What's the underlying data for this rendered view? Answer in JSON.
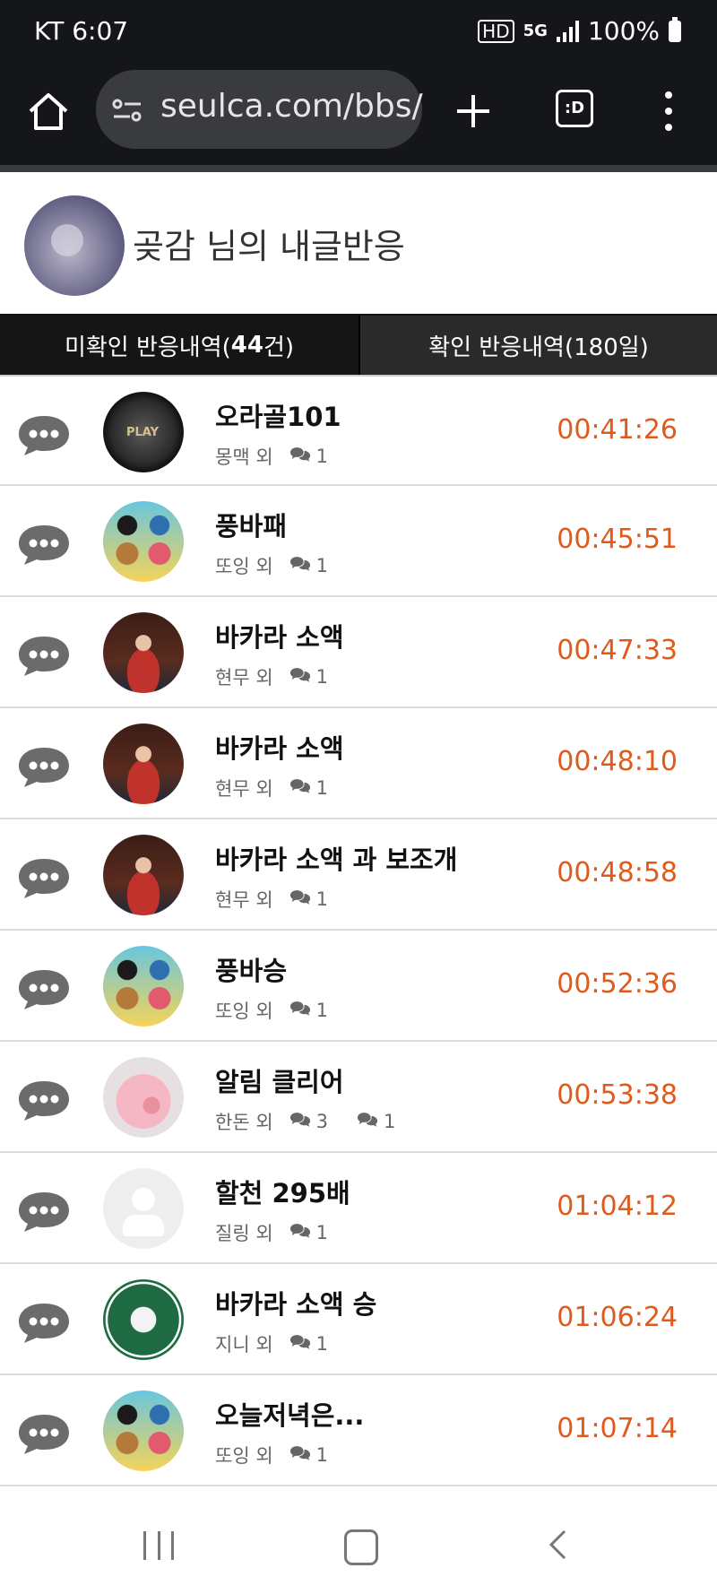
{
  "status_bar": {
    "carrier_time": "KT 6:07",
    "battery": "100%",
    "net_badge": "HD",
    "net_type": "5G"
  },
  "browser": {
    "url": "seulca.com/bbs/",
    "tabs_icon_label": ":D"
  },
  "profile": {
    "title": "곶감 님의 내글반응"
  },
  "tabs": {
    "unconfirmed_prefix": "미확인 반응내역(",
    "unconfirmed_count": "44",
    "unconfirmed_suffix": "건)",
    "confirmed": "확인 반응내역(180일)"
  },
  "items": [
    {
      "title": "오라골101",
      "who": "몽맥 외",
      "comments": "1",
      "time": "00:41:26",
      "thumb": "play-logo"
    },
    {
      "title": "풍바패",
      "who": "또잉 외",
      "comments": "1",
      "time": "00:45:51",
      "thumb": "cartoon-animals"
    },
    {
      "title": "바카라 소액",
      "who": "현무 외",
      "comments": "1",
      "time": "00:47:33",
      "thumb": "dealer-photo"
    },
    {
      "title": "바카라 소액",
      "who": "현무 외",
      "comments": "1",
      "time": "00:48:10",
      "thumb": "dealer-photo"
    },
    {
      "title": "바카라 소액 과 보조개",
      "who": "현무 외",
      "comments": "1",
      "time": "00:48:58",
      "thumb": "dealer-photo"
    },
    {
      "title": "풍바승",
      "who": "또잉 외",
      "comments": "1",
      "time": "00:52:36",
      "thumb": "cartoon-animals"
    },
    {
      "title": "알림 클리어",
      "who": "한돈 외",
      "comments": "3",
      "comments2": "1",
      "time": "00:53:38",
      "thumb": "pig"
    },
    {
      "title": "할천 295배",
      "who": "질링 외",
      "comments": "1",
      "time": "01:04:12",
      "thumb": "default-avatar"
    },
    {
      "title": "바카라 소액 승",
      "who": "지니 외",
      "comments": "1",
      "time": "01:06:24",
      "thumb": "starbucks-logo"
    },
    {
      "title": "오늘저녁은...",
      "who": "또잉 외",
      "comments": "1",
      "time": "01:07:14",
      "thumb": "cartoon-animals"
    }
  ],
  "colors": {
    "time": "#e05a1c",
    "dark_bar": "#15161a"
  }
}
